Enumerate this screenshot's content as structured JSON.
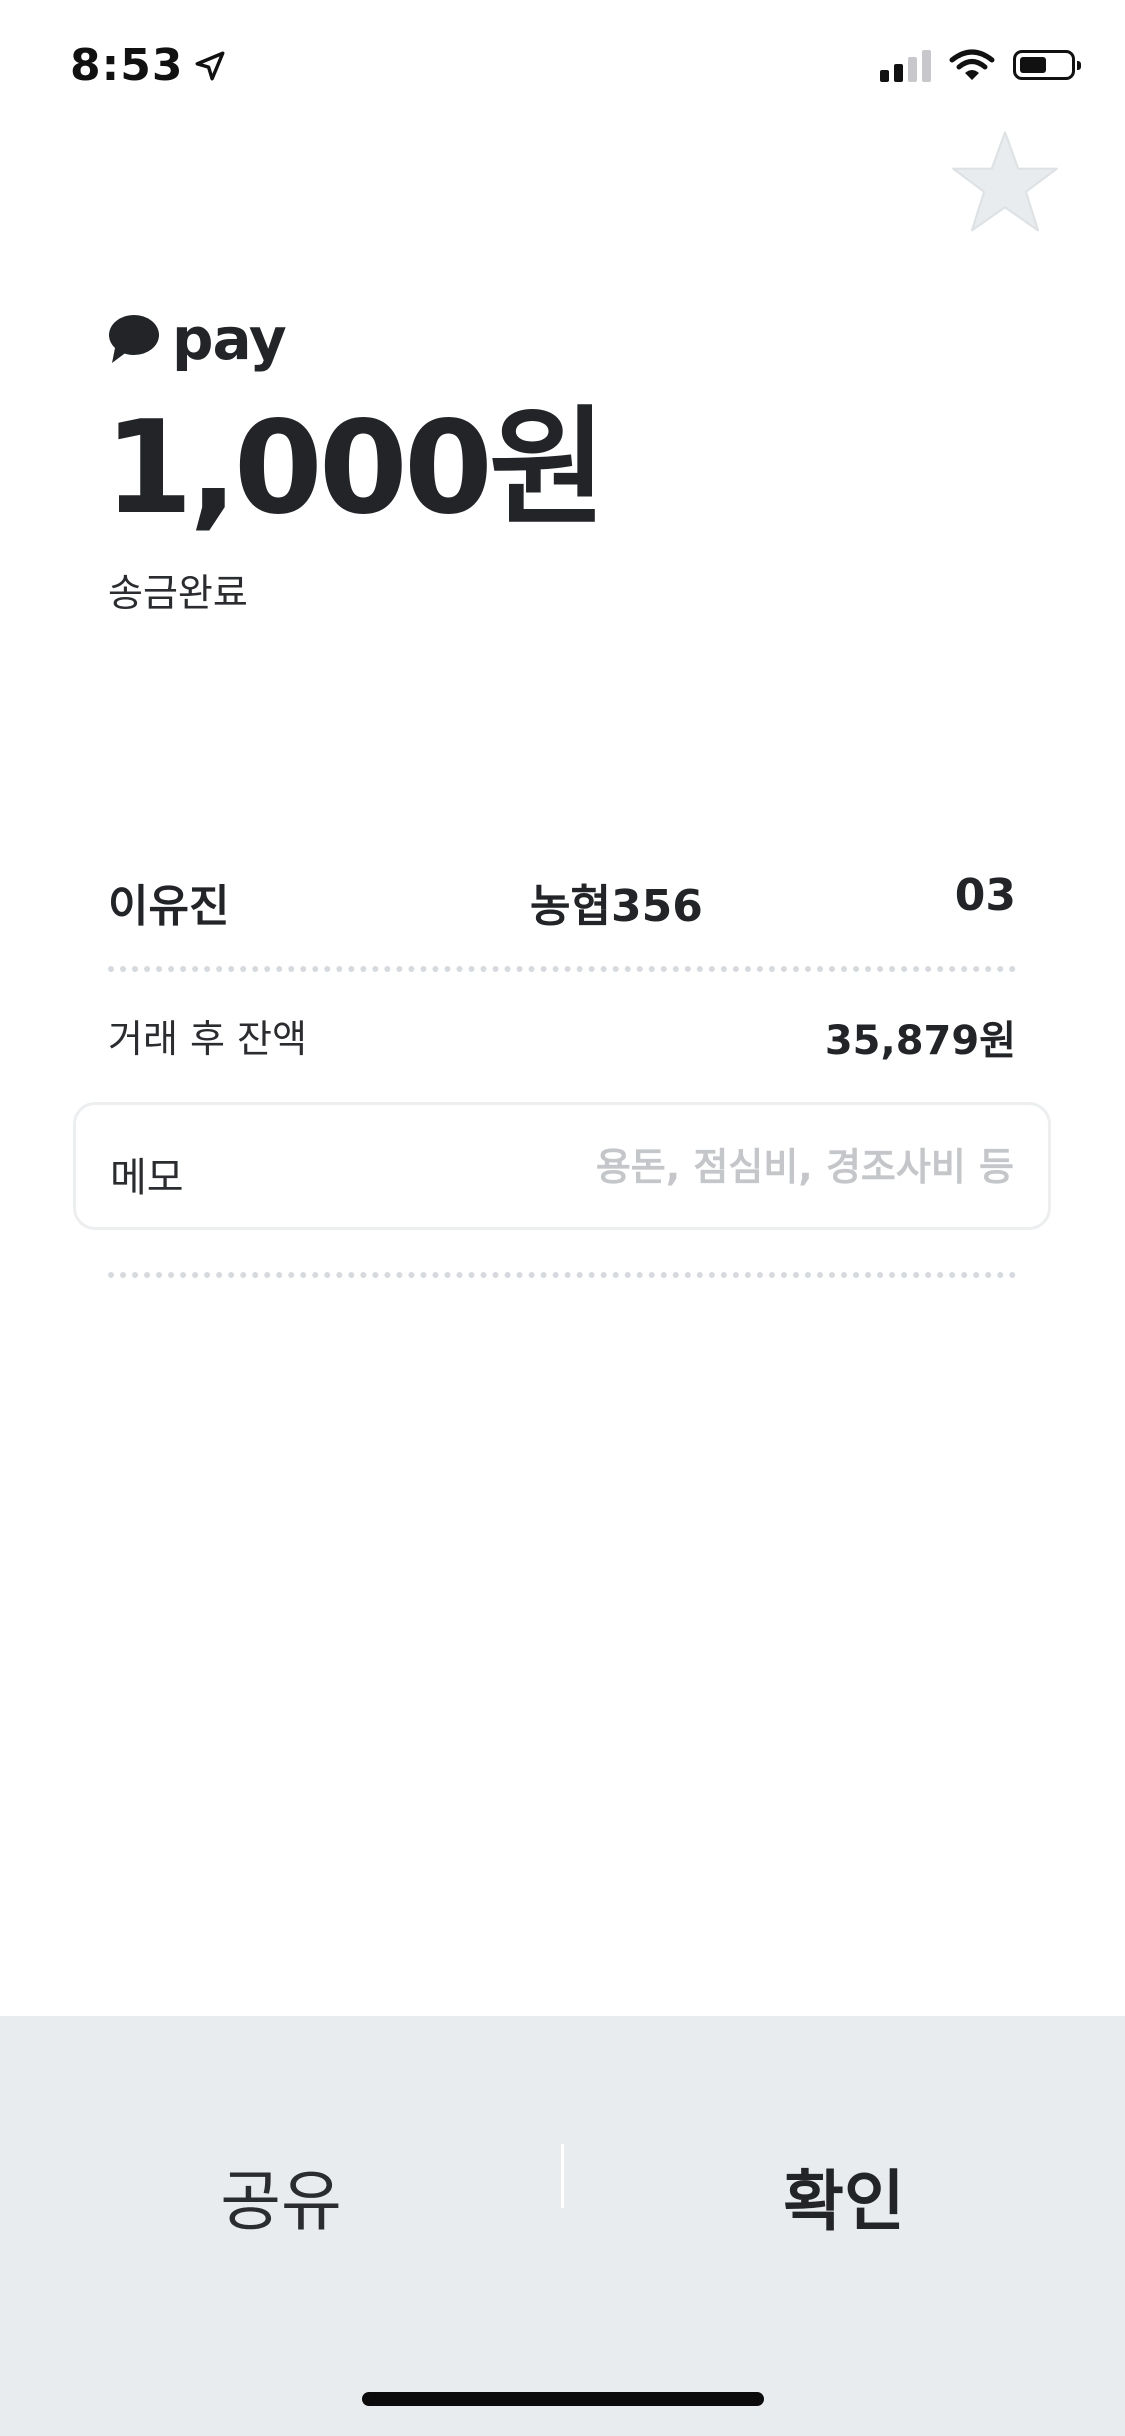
{
  "status_bar": {
    "time": "8:53",
    "icons": [
      "location-arrow-icon",
      "cellular-signal-icon",
      "wifi-icon",
      "battery-icon"
    ]
  },
  "favorite": {
    "icon": "star-icon",
    "color": "#e9ecef"
  },
  "logo": {
    "icon": "speech-bubble-icon",
    "text": "pay"
  },
  "transfer": {
    "amount": "1,000원",
    "status": "송금완료"
  },
  "recipient": {
    "name": "이유진",
    "bank_account": "농협356",
    "account_suffix": "03"
  },
  "balance": {
    "label": "거래 후 잔액",
    "value": "35,879원"
  },
  "memo": {
    "label": "메모",
    "value": "",
    "placeholder": "용돈, 점심비, 경조사비 등"
  },
  "actions": {
    "share_label": "공유",
    "confirm_label": "확인"
  },
  "colors": {
    "text": "#222428",
    "bottom_bar": "#e9ecee",
    "placeholder": "#c4c6c9",
    "dots": "#d6d9dd"
  }
}
